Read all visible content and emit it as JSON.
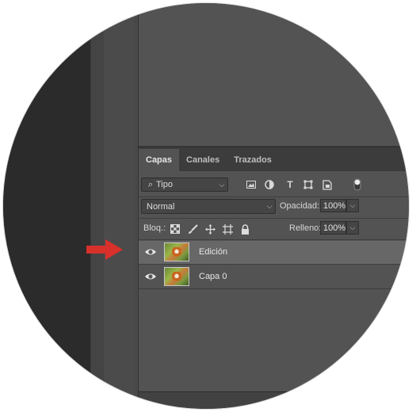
{
  "tabs": [
    {
      "label": "Capas",
      "active": true
    },
    {
      "label": "Canales",
      "active": false
    },
    {
      "label": "Trazados",
      "active": false
    }
  ],
  "filter": {
    "kind_label": "Tipo"
  },
  "blend": {
    "mode": "Normal",
    "opacity_label": "Opacidad:",
    "opacity_value": "100%"
  },
  "lock": {
    "label": "Bloq.:",
    "fill_label": "Relleno:",
    "fill_value": "100%"
  },
  "layers": [
    {
      "name": "Edición",
      "selected": true,
      "visible": true
    },
    {
      "name": "Capa 0",
      "selected": false,
      "visible": true
    }
  ],
  "colors": {
    "panel_bg": "#535353",
    "selected_row": "#676767",
    "arrow": "#d8302a"
  }
}
